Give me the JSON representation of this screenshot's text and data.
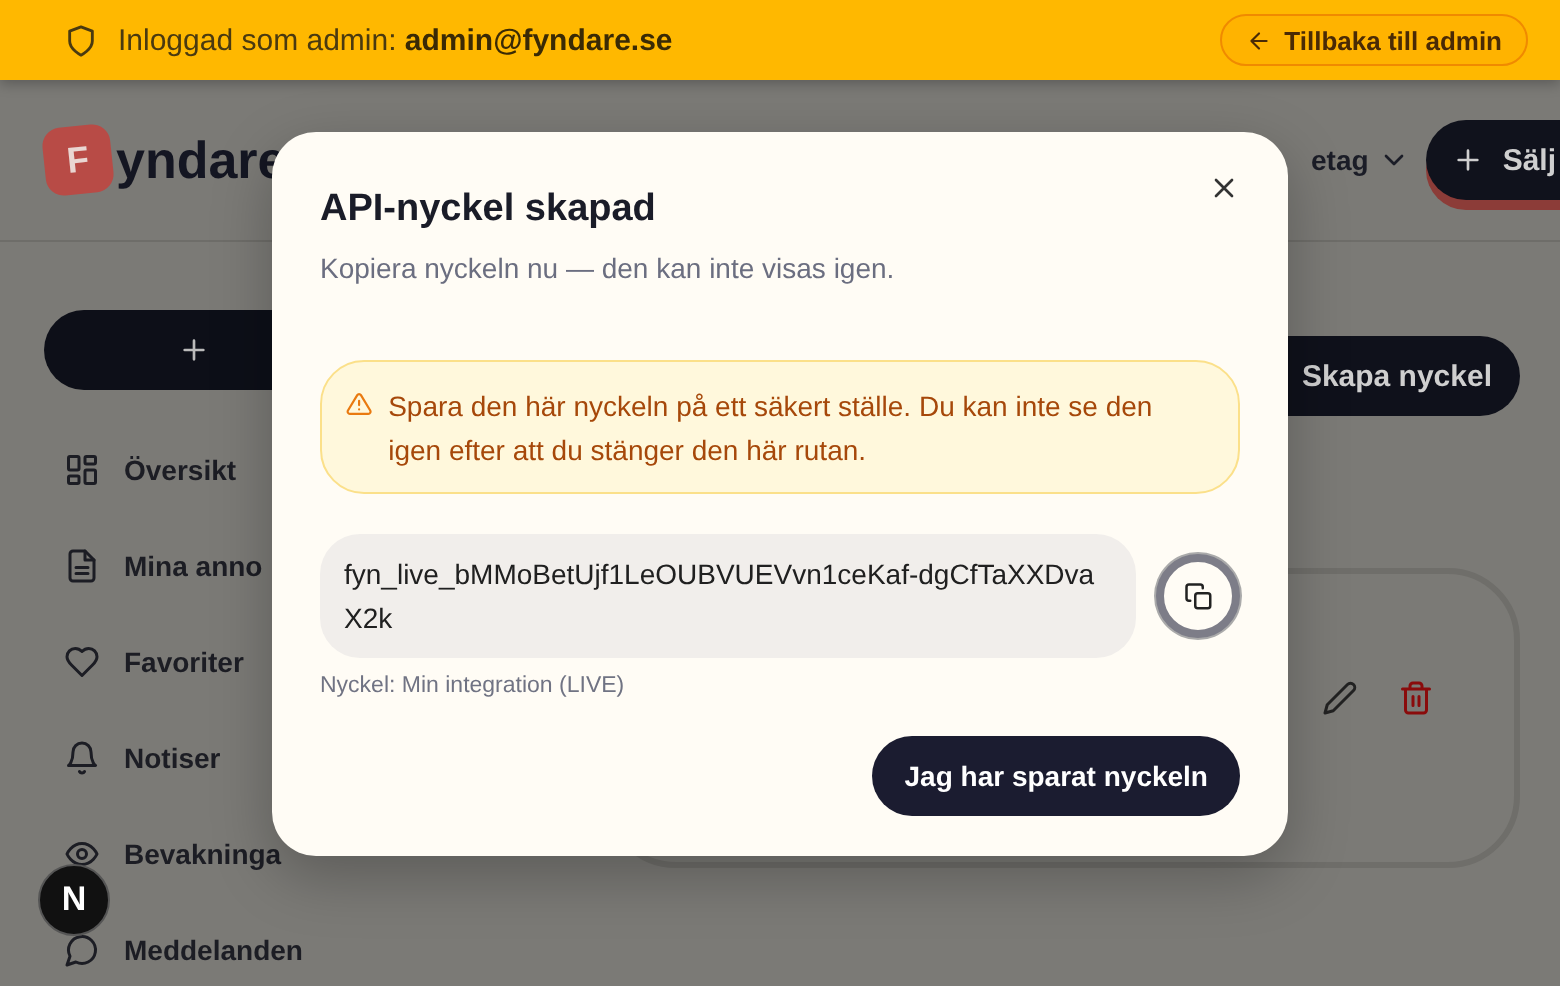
{
  "banner": {
    "text": "Inloggad som admin: **admin@fyndare.se**",
    "back_button": "Tillbaka till admin"
  },
  "header": {
    "logo_letter": "F",
    "logo_text": "yndare",
    "menu_label": "etag",
    "sell_button": "Sälj"
  },
  "sidebar": {
    "items": [
      {
        "label": "Översikt"
      },
      {
        "label": "Mina anno"
      },
      {
        "label": "Favoriter"
      },
      {
        "label": "Notiser"
      },
      {
        "label": "Bevakninga"
      },
      {
        "label": "Meddelanden"
      }
    ]
  },
  "main": {
    "create_button": "Skapa nyckel"
  },
  "dev_badge": "N",
  "dialog": {
    "title": "API-nyckel skapad",
    "subtitle": "Kopiera nyckeln nu — den kan inte visas igen.",
    "warning": "Spara den här nyckeln på ett säkert ställe. Du kan inte se den igen efter att du stänger den här rutan.",
    "key": "fyn_live_bMMoBetUjf1LeOUBVUEVvn1ceKaf-dgCfTaXXDvaX2k",
    "key_caption": "Nyckel: Min integration (LIVE)",
    "confirm_button": "Jag har sparat nyckeln"
  }
}
